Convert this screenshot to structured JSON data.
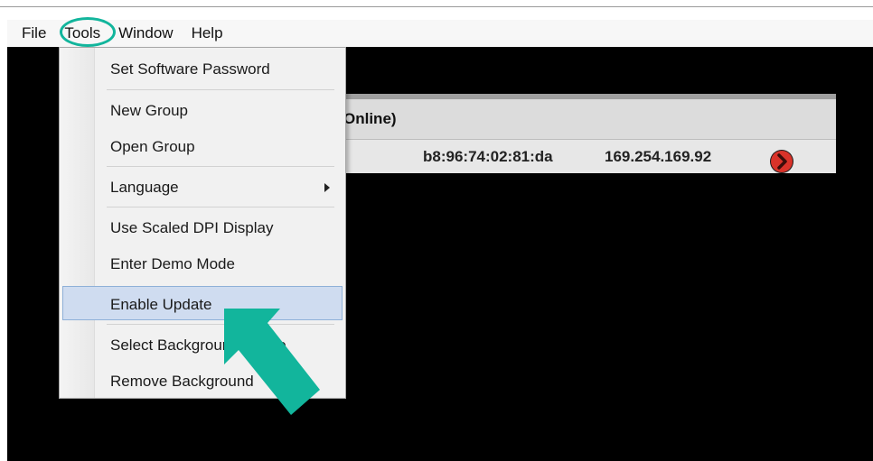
{
  "menubar": {
    "items": [
      {
        "label": "File"
      },
      {
        "label": "Tools"
      },
      {
        "label": "Window"
      },
      {
        "label": "Help"
      }
    ]
  },
  "tools_menu": {
    "items": [
      {
        "label": "Set Software Password"
      },
      {
        "label": "New Group"
      },
      {
        "label": "Open Group"
      },
      {
        "label": "Language",
        "has_submenu": true
      },
      {
        "label": "Use Scaled DPI Display"
      },
      {
        "label": "Enter Demo Mode"
      },
      {
        "label": "Enable Update",
        "highlighted": true
      },
      {
        "label": "Select Background Image"
      },
      {
        "label": "Remove Background"
      }
    ]
  },
  "device_panel": {
    "title": "Online)",
    "rows": [
      {
        "mac": "b8:96:74:02:81:da",
        "ip": "169.254.169.92"
      }
    ]
  },
  "annotation": {
    "highlight_color": "#12b59c",
    "ring_target": "Tools",
    "arrow_target": "Enable Update"
  },
  "colors": {
    "canvas": "#000000",
    "menu_highlight": "#cfdcf0",
    "go_button": "#d9332a"
  }
}
